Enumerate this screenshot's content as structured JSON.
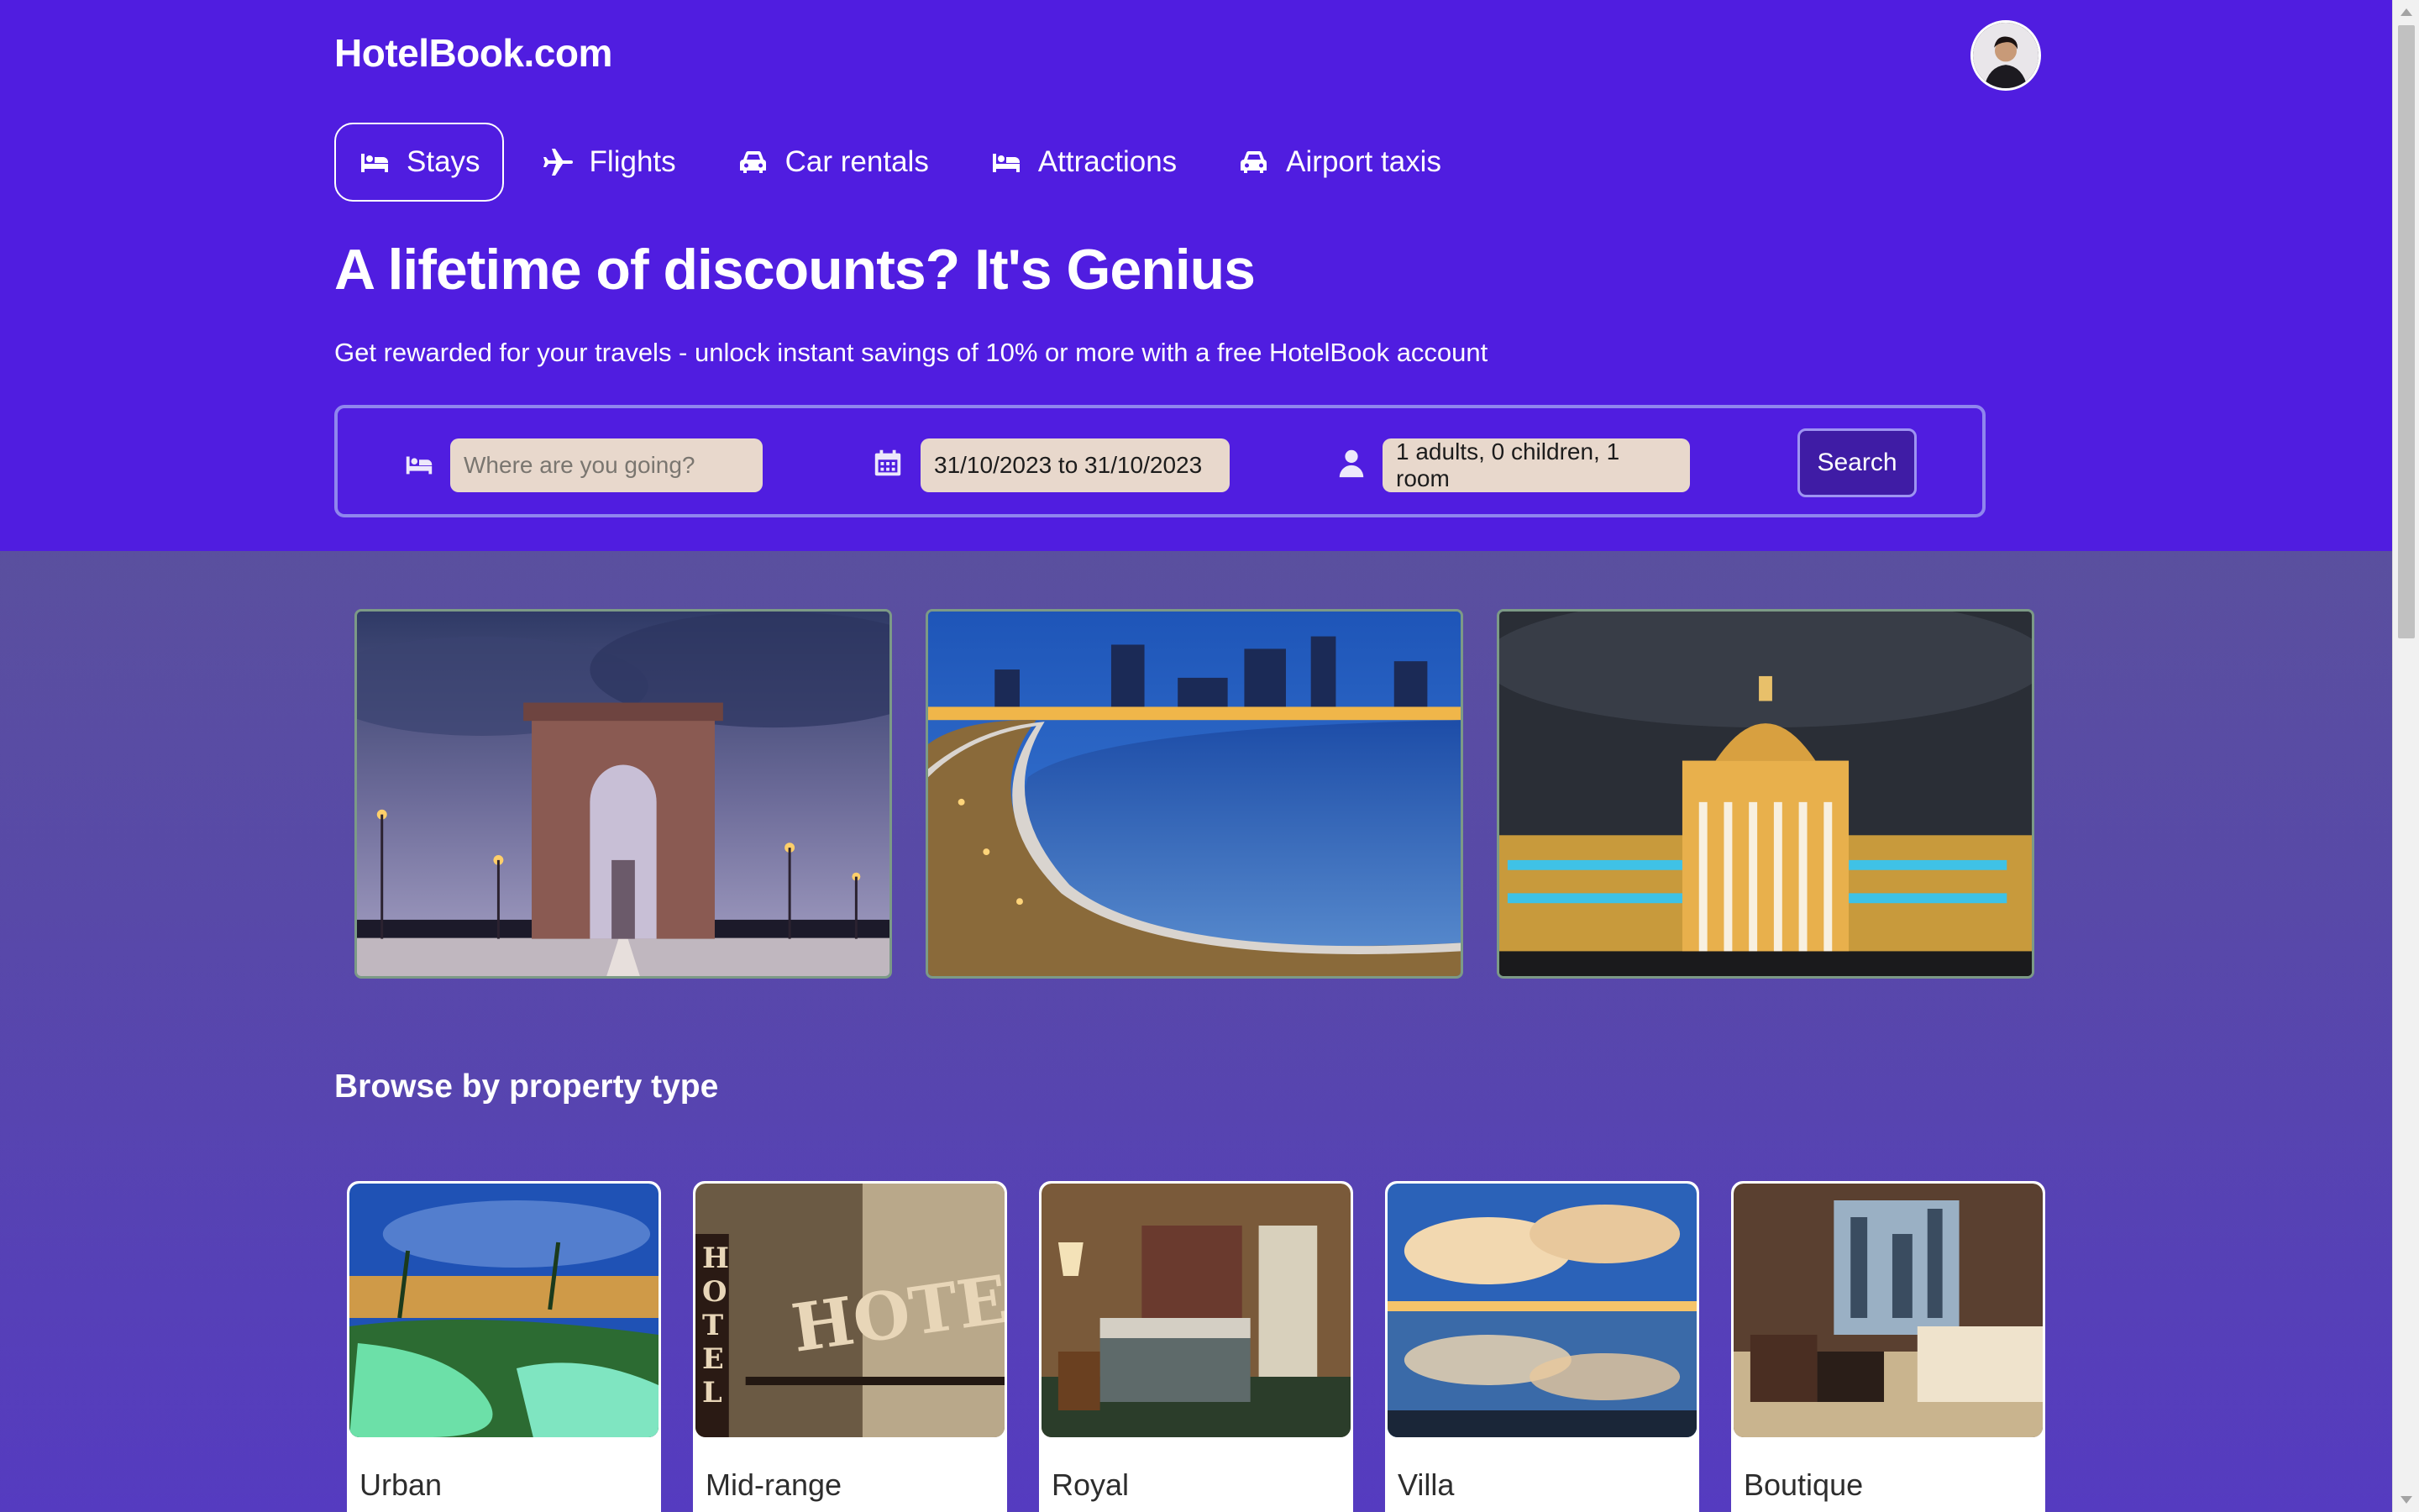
{
  "header": {
    "logo": "HotelBook.com",
    "avatar_icon": "user-avatar",
    "background": "#501de0"
  },
  "nav": {
    "items": [
      {
        "label": "Stays",
        "icon": "bed-icon",
        "active": true
      },
      {
        "label": "Flights",
        "icon": "plane-icon",
        "active": false
      },
      {
        "label": "Car rentals",
        "icon": "car-icon",
        "active": false
      },
      {
        "label": "Attractions",
        "icon": "bed-icon",
        "active": false
      },
      {
        "label": "Airport taxis",
        "icon": "taxi-icon",
        "active": false
      }
    ]
  },
  "hero": {
    "title": "A lifetime of discounts? It's Genius",
    "subtitle": "Get rewarded for your travels - unlock instant savings of 10% or more with a free HotelBook account"
  },
  "search": {
    "destination_placeholder": "Where are you going?",
    "destination_value": "",
    "dates": "31/10/2023 to 31/10/2023",
    "guests": "1 adults, 0 children, 1 room",
    "button_label": "Search"
  },
  "featured": [
    {
      "name": "india-gate-image"
    },
    {
      "name": "marine-drive-image"
    },
    {
      "name": "vidhana-soudha-image"
    }
  ],
  "property_section": {
    "title": "Browse by property type",
    "items": [
      {
        "label": "Urban"
      },
      {
        "label": "Mid-range"
      },
      {
        "label": "Royal"
      },
      {
        "label": "Villa"
      },
      {
        "label": "Boutique"
      }
    ]
  },
  "colors": {
    "accent": "#501de0",
    "search_button": "#3f1ca5",
    "field_bg": "#e8d8cc"
  }
}
